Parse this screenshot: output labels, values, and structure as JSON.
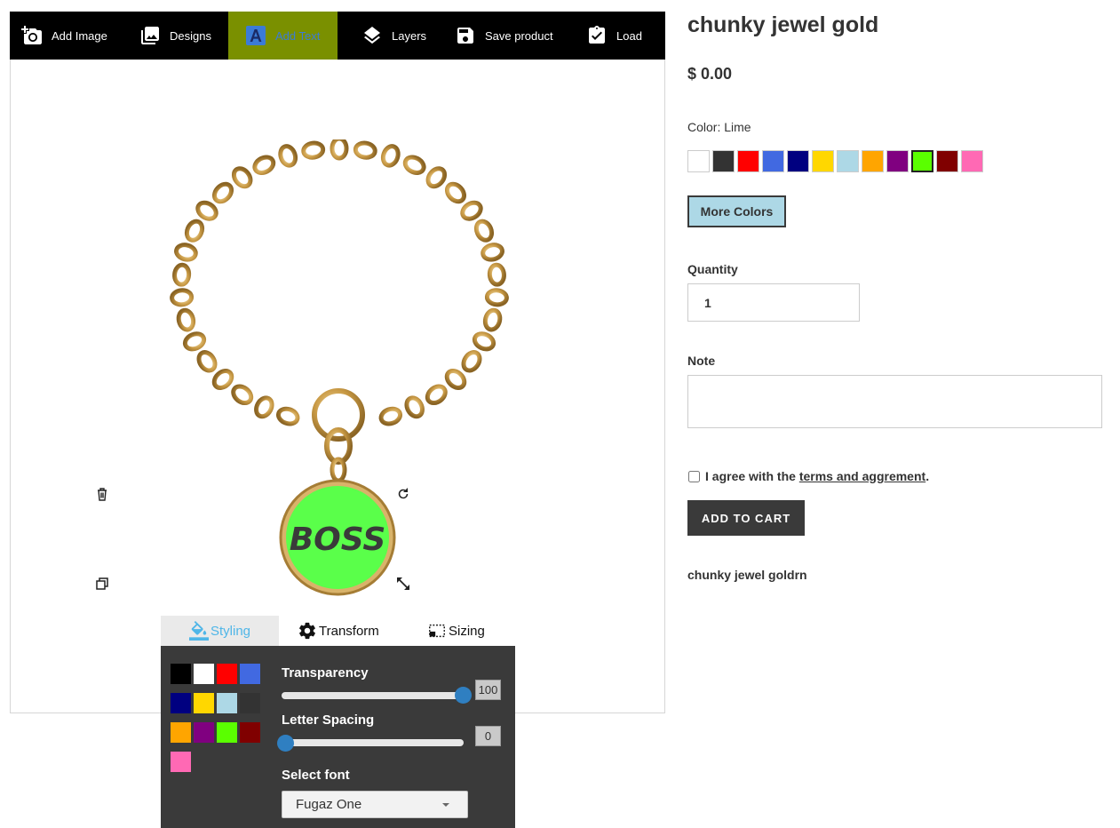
{
  "toolbar": {
    "items": [
      {
        "label": "Add Image",
        "icon": "add-photo-icon"
      },
      {
        "label": "Designs",
        "icon": "image-gallery-icon"
      },
      {
        "label": "Add Text",
        "icon": "text-icon",
        "active": true
      },
      {
        "label": "Layers",
        "icon": "layers-icon"
      },
      {
        "label": "Save product",
        "icon": "save-icon"
      },
      {
        "label": "Load",
        "icon": "clipboard-check-icon"
      }
    ],
    "active_bg": "#7a9000"
  },
  "design": {
    "pendant_text": "BOSS",
    "pendant_color": "#5aff4a",
    "controls": [
      "trash-icon",
      "rotate-icon",
      "duplicate-icon",
      "resize-icon"
    ]
  },
  "tool_tabs": [
    {
      "label": "Styling",
      "icon": "paint-bucket-icon",
      "active": true
    },
    {
      "label": "Transform",
      "icon": "gear-icon"
    },
    {
      "label": "Sizing",
      "icon": "sizing-icon"
    }
  ],
  "styling_panel": {
    "text_colors": [
      "#000000",
      "#ffffff",
      "#ff0000",
      "#4169e1",
      "#000080",
      "#ffd700",
      "#add8e6",
      "#333333",
      "#ffa500",
      "#800080",
      "#5aff00",
      "#800000",
      "#ff69b4"
    ],
    "transparency_label": "Transparency",
    "transparency_value": "100",
    "letter_spacing_label": "Letter Spacing",
    "letter_spacing_value": "0",
    "font_label": "Select font",
    "font_selected": "Fugaz One"
  },
  "product": {
    "title": "chunky jewel gold",
    "price": "$ 0.00",
    "color_label": "Color: Lime",
    "colors": [
      "#ffffff",
      "#333333",
      "#ff0000",
      "#4169e1",
      "#000080",
      "#ffd700",
      "#add8e6",
      "#ffa500",
      "#800080",
      "#5aff00",
      "#800000",
      "#ff69b4"
    ],
    "selected_color_index": 9,
    "more_colors_label": "More Colors",
    "quantity_label": "Quantity",
    "quantity_value": "1",
    "note_label": "Note",
    "agree_prefix": "I agree with the",
    "agree_link": "terms and aggrement",
    "agree_suffix": ".",
    "add_to_cart": "ADD TO CART",
    "description": "chunky jewel goldrn"
  }
}
